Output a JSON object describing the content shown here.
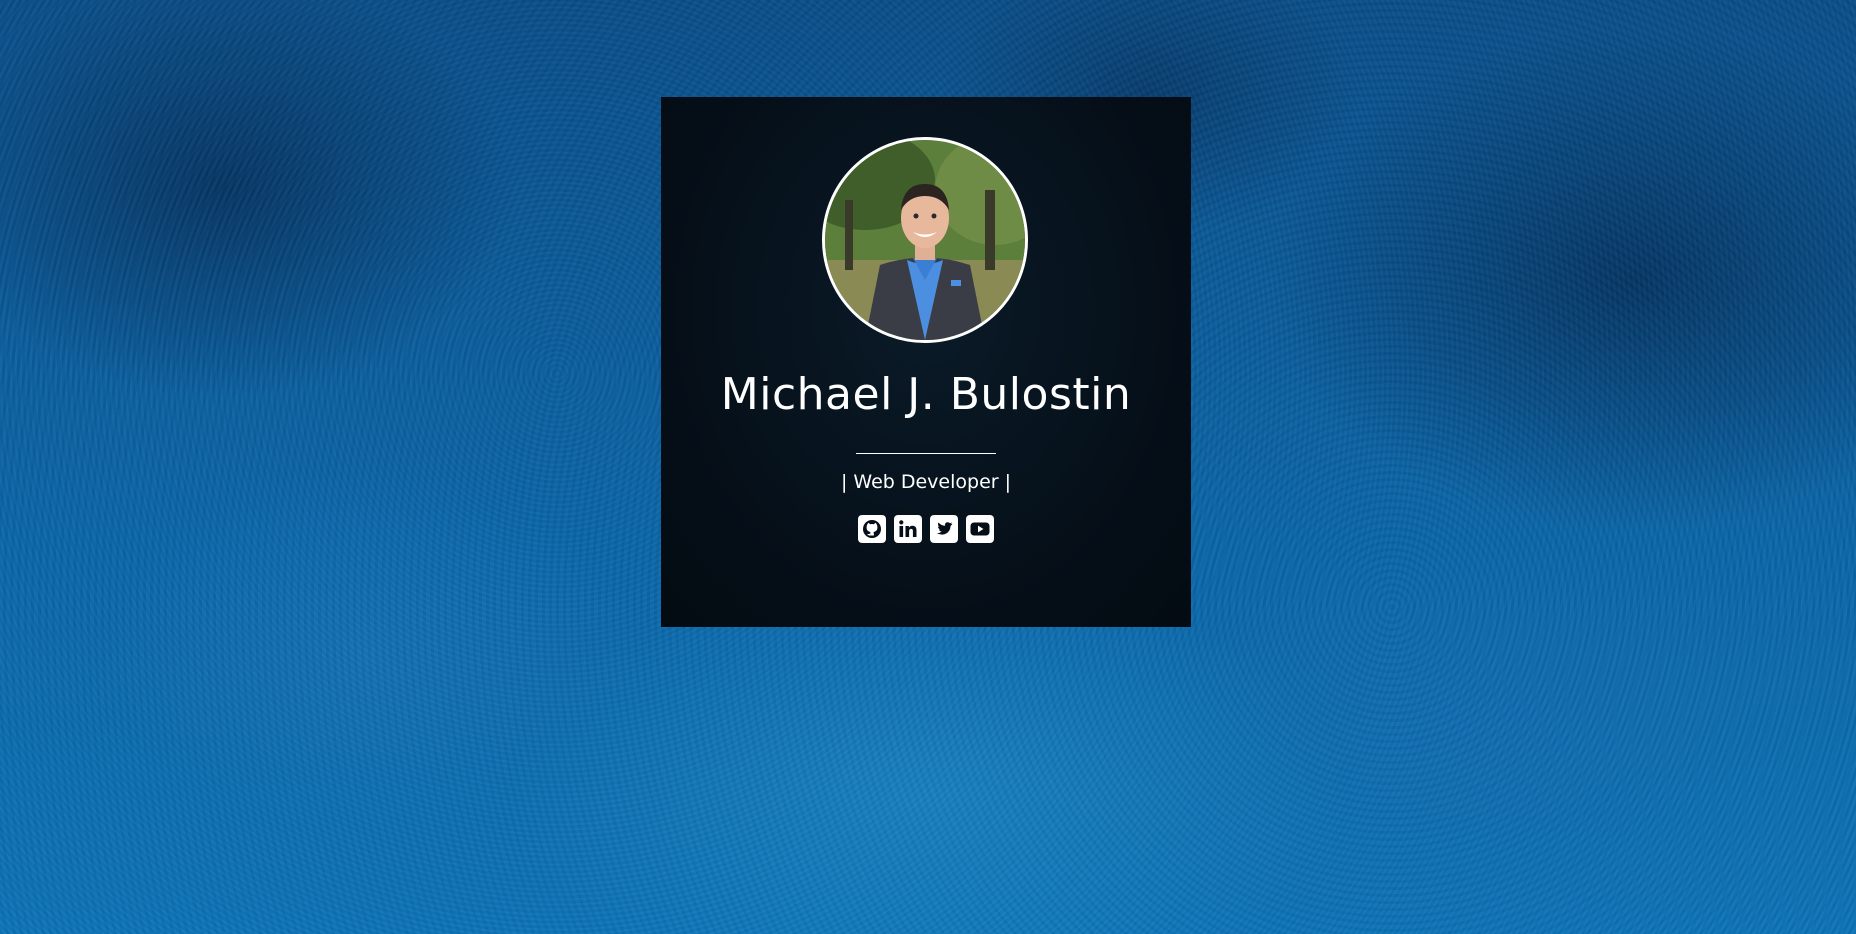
{
  "profile": {
    "name": "Michael J. Bulostin",
    "role": "| Web Developer |"
  },
  "socials": [
    {
      "icon": "github-icon"
    },
    {
      "icon": "linkedin-icon"
    },
    {
      "icon": "twitter-icon"
    },
    {
      "icon": "youtube-icon"
    }
  ],
  "colors": {
    "background": "#0b5c99",
    "card": "#050e17",
    "text": "#ffffff"
  }
}
